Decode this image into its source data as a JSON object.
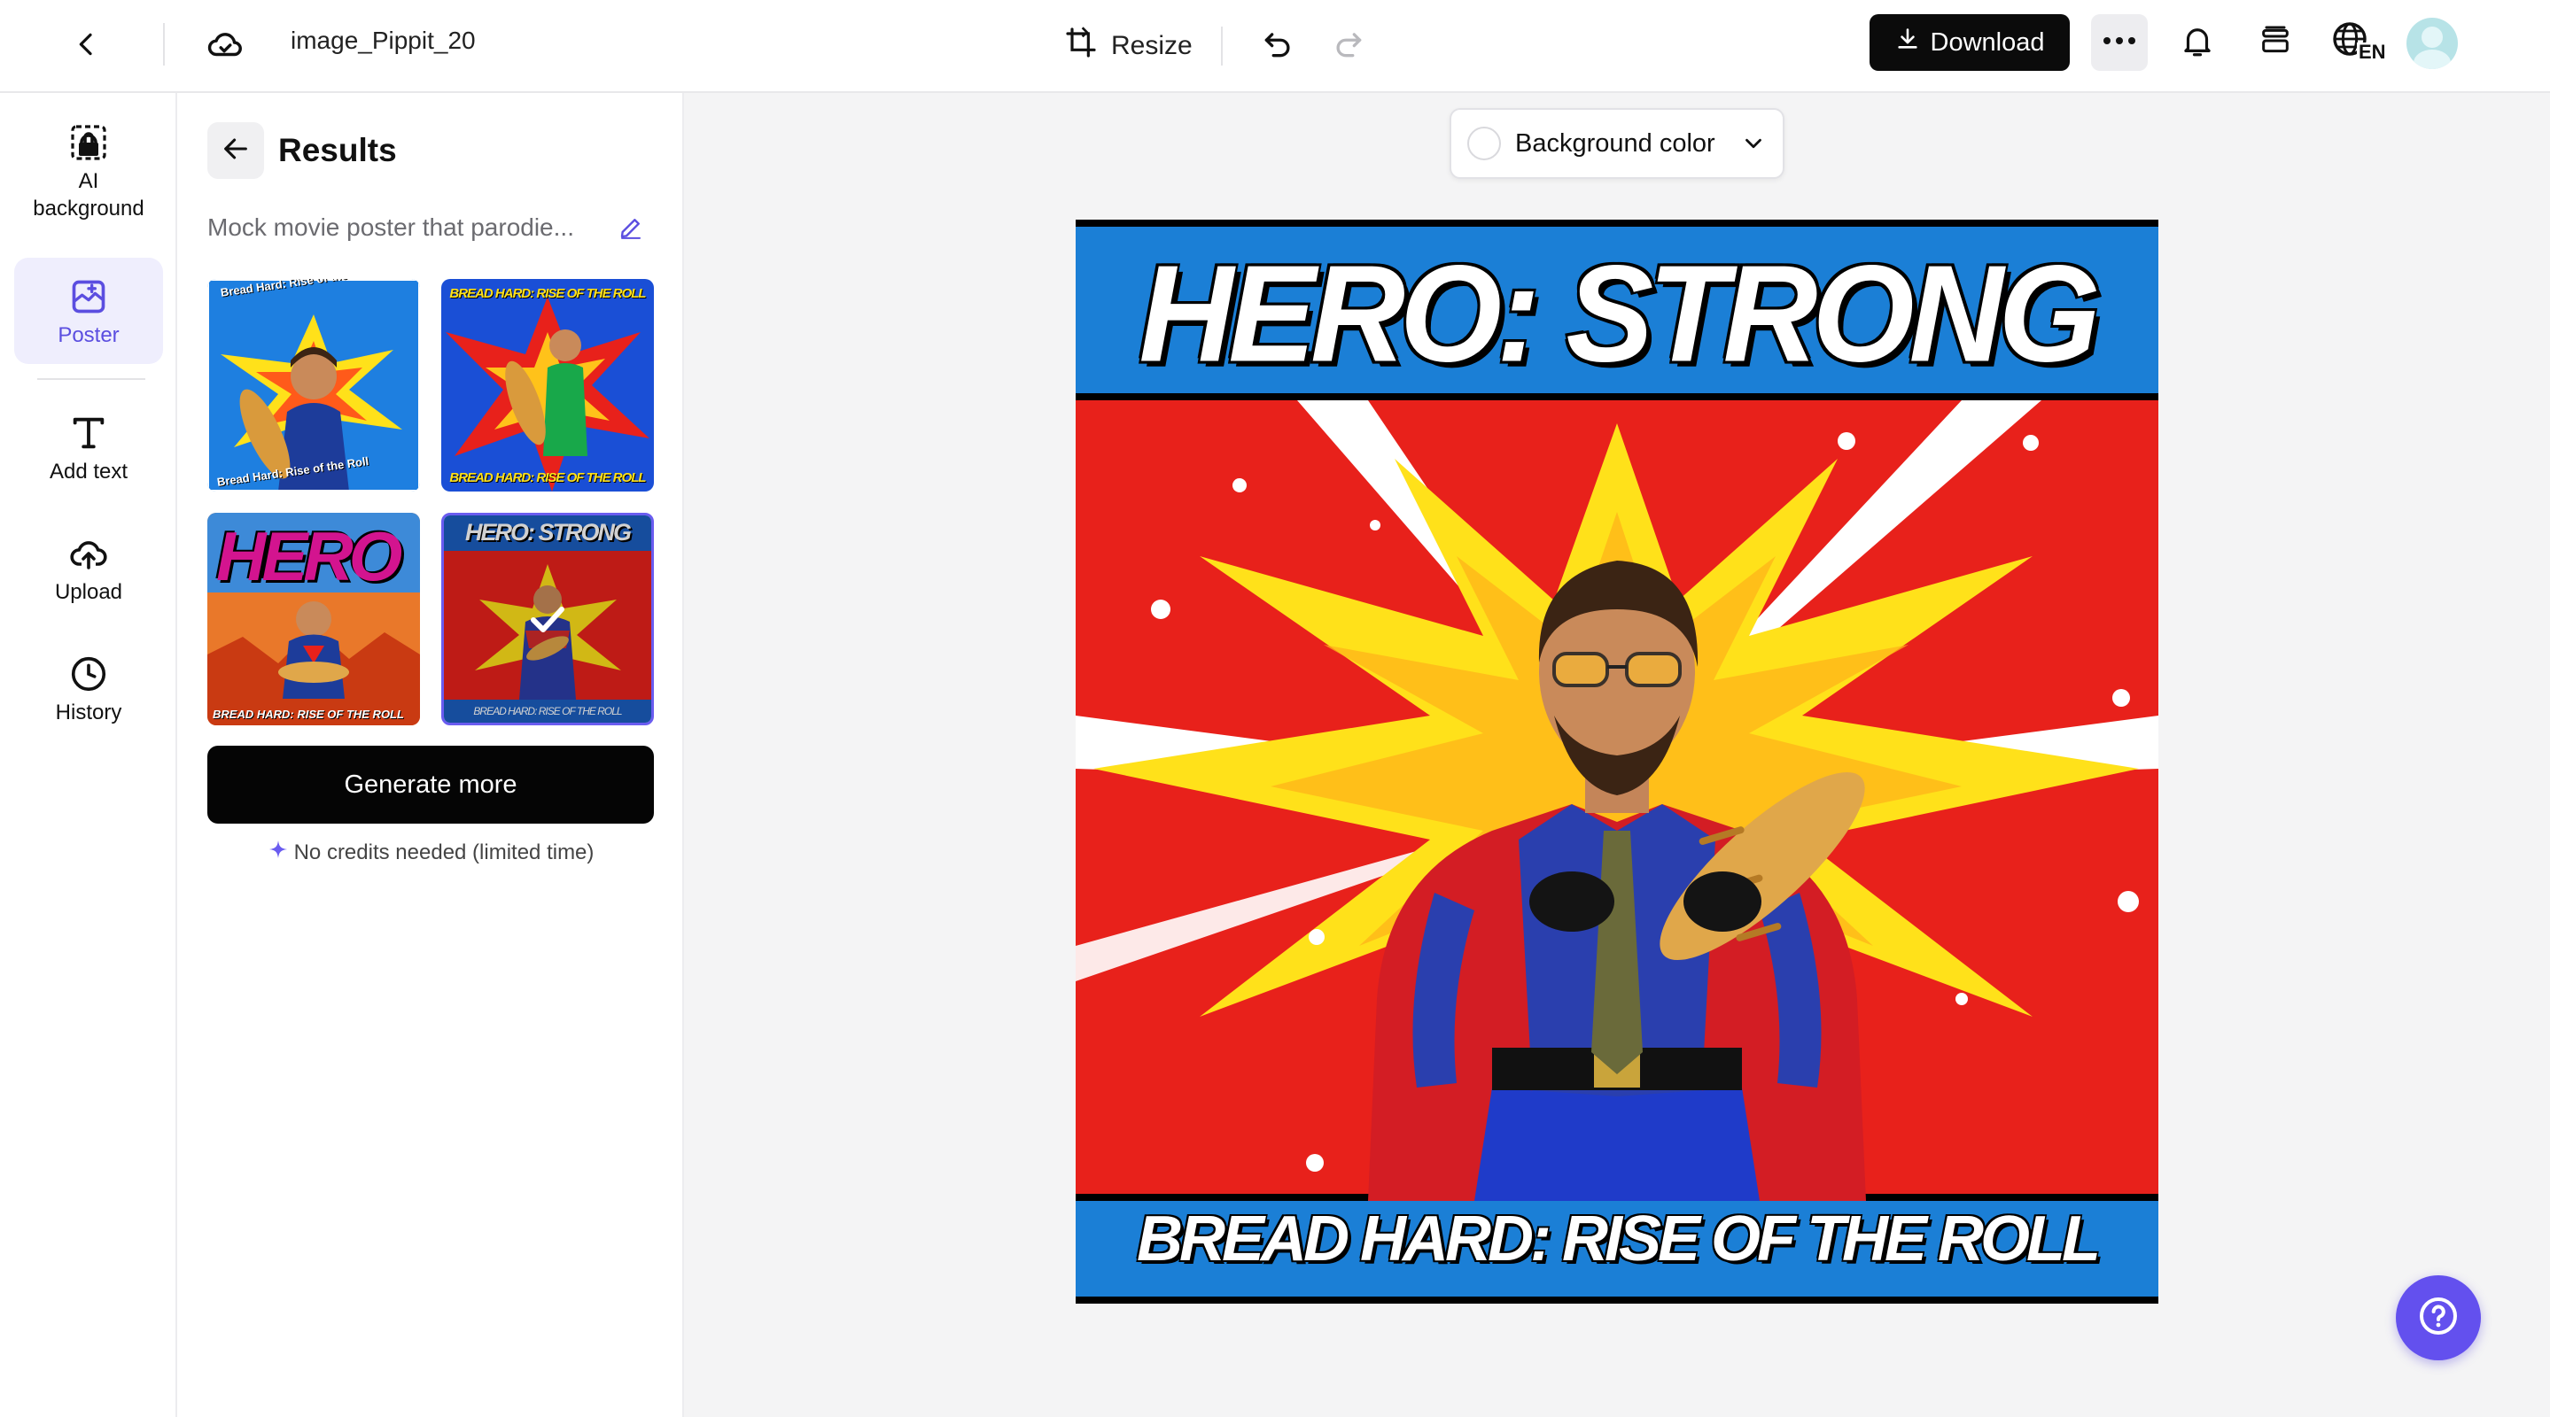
{
  "header": {
    "file_name": "image_Pippit_20",
    "resize_label": "Resize",
    "download_label": "Download",
    "language_badge": "EN"
  },
  "rail": {
    "items": [
      {
        "label": "AI background",
        "icon": "ai-background-icon"
      },
      {
        "label": "Poster",
        "icon": "poster-icon",
        "active": true
      },
      {
        "label": "Add text",
        "icon": "text-icon"
      },
      {
        "label": "Upload",
        "icon": "upload-icon"
      },
      {
        "label": "History",
        "icon": "history-icon"
      }
    ]
  },
  "results": {
    "title": "Results",
    "prompt": "Mock movie poster that parodie...",
    "thumbnails": [
      {
        "caption_top": "Bread Hard: Rise of the Roll",
        "caption_bottom": "Bread Hard: Rise of the Roll"
      },
      {
        "caption_top": "BREAD HARD: RISE OF THE ROLL",
        "caption_bottom": "BREAD HARD: RISE OF THE ROLL"
      },
      {
        "caption_top": "HERO",
        "caption_bottom": "BREAD HARD: RISE OF THE ROLL"
      },
      {
        "caption_top": "HERO: STRONG",
        "caption_bottom": "BREAD HARD: RISE OF THE ROLL",
        "selected": true
      }
    ],
    "generate_label": "Generate more",
    "credits_note": "No credits needed (limited time)"
  },
  "canvas": {
    "background_color_label": "Background color",
    "poster_title": "HERO: STRONG",
    "poster_subtitle": "BREAD HARD: RISE OF THE ROLL"
  },
  "colors": {
    "accent": "#5b4ee0",
    "poster_blue": "#1b7fd6",
    "poster_red": "#e8211b",
    "poster_yellow": "#ffe11a"
  }
}
